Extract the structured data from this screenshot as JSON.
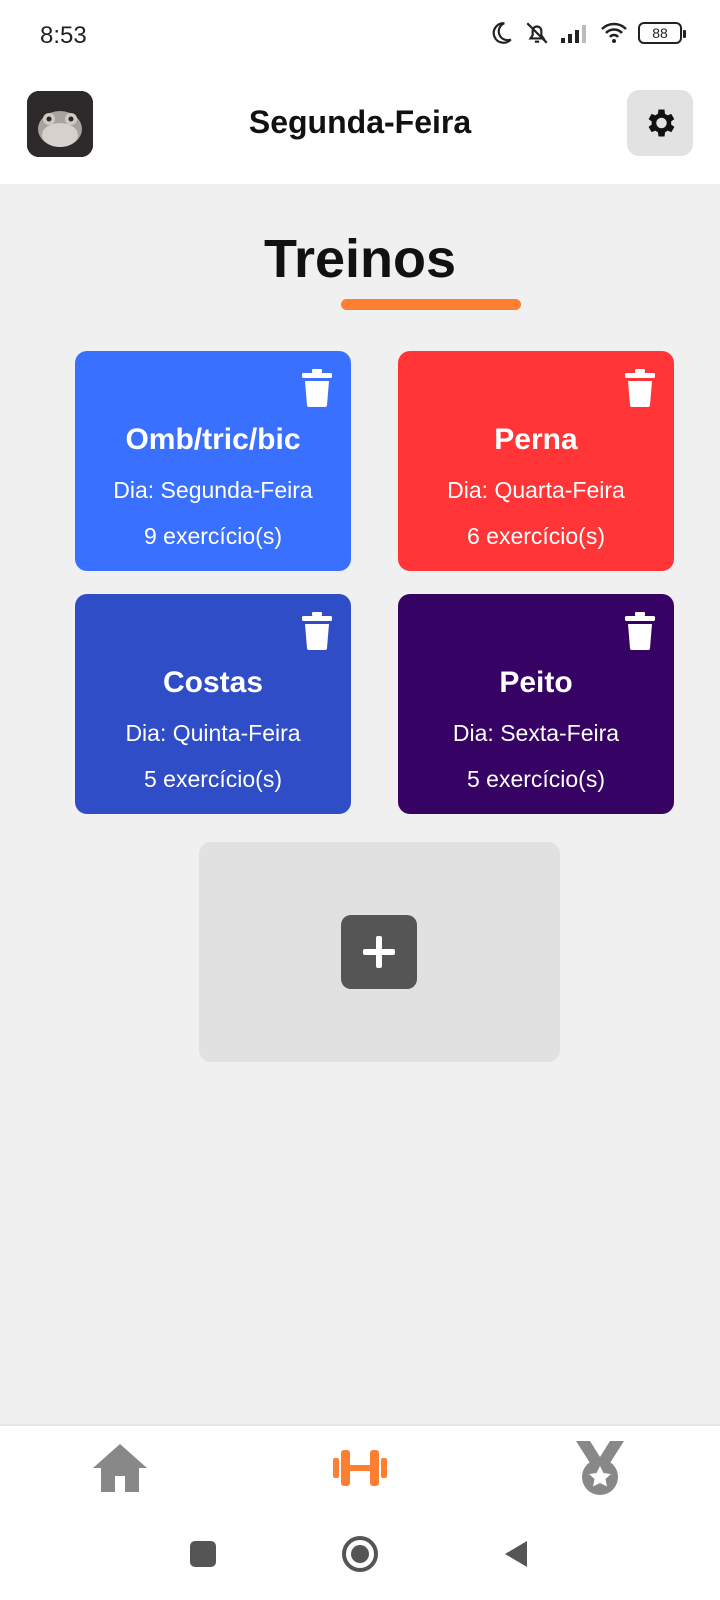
{
  "status_bar": {
    "time": "8:53",
    "battery": "88",
    "icons": [
      "moon-icon",
      "bell-off-icon",
      "signal-icon",
      "wifi-icon",
      "battery-icon"
    ]
  },
  "header": {
    "title": "Segunda-Feira",
    "avatar_icon": "frog-avatar",
    "settings_icon": "gear-icon"
  },
  "section": {
    "title": "Treinos",
    "accent": "#ff7f32"
  },
  "workouts": [
    {
      "name": "Omb/tric/bic",
      "day": "Dia: Segunda-Feira",
      "count": "9 exercício(s)",
      "color": "#3a70ff"
    },
    {
      "name": "Perna",
      "day": "Dia: Quarta-Feira",
      "count": "6 exercício(s)",
      "color": "#ff3538"
    },
    {
      "name": "Costas",
      "day": "Dia: Quinta-Feira",
      "count": "5 exercício(s)",
      "color": "#2e4dc6"
    },
    {
      "name": "Peito",
      "day": "Dia: Sexta-Feira",
      "count": "5 exercício(s)",
      "color": "#360264"
    }
  ],
  "add_button_icon": "plus-icon",
  "bottom_nav": {
    "items": [
      {
        "icon": "home-icon",
        "active": false
      },
      {
        "icon": "dumbbell-icon",
        "active": true
      },
      {
        "icon": "medal-icon",
        "active": false
      }
    ],
    "active_color": "#ff7f32",
    "inactive_color": "#888888"
  }
}
